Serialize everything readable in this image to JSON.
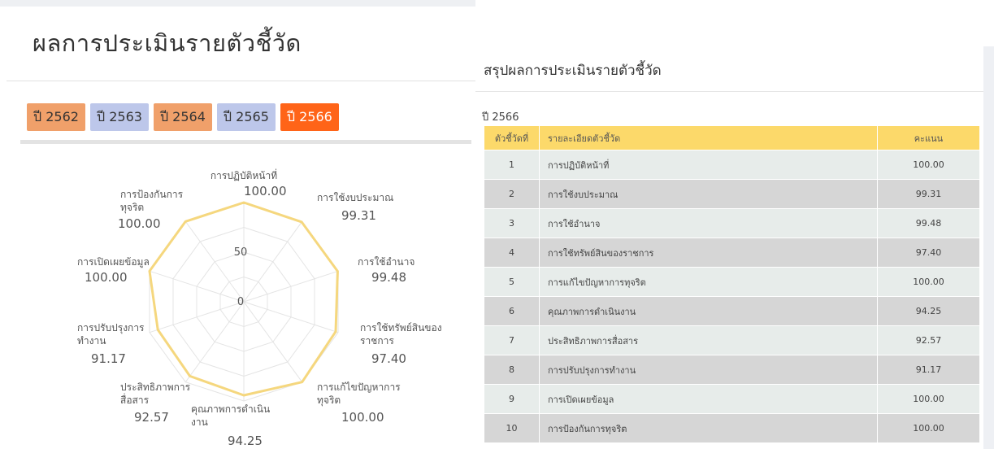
{
  "page_title": "ผลการประเมินรายตัวชี้วัด",
  "year_tabs": [
    {
      "label": "ปี 2562",
      "color": "#f0a06a",
      "active": false
    },
    {
      "label": "ปี 2563",
      "color": "#bdc7ea",
      "active": false
    },
    {
      "label": "ปี 2564",
      "color": "#f0a06a",
      "active": false
    },
    {
      "label": "ปี 2565",
      "color": "#bdc7ea",
      "active": false
    },
    {
      "label": "ปี 2566",
      "color": "#ff6418",
      "active": true
    }
  ],
  "chart_data": {
    "type": "radar",
    "rlim": [
      0,
      100
    ],
    "radial_ticks": [
      "0",
      "50",
      "100.00"
    ],
    "line_color": "#f5d77e",
    "axes": [
      {
        "label": "การปฏิบัติหน้าที่",
        "value": 100.0,
        "value_label": "100.00"
      },
      {
        "label": "การใช้งบประมาณ",
        "value": 99.31,
        "value_label": "99.31"
      },
      {
        "label": "การใช้อำนาจ",
        "value": 99.48,
        "value_label": "99.48"
      },
      {
        "label": "การใช้ทรัพย์สินของราชการ",
        "value": 97.4,
        "value_label": "97.40"
      },
      {
        "label": "การแก้ไขปัญหาการทุจริต",
        "value": 100.0,
        "value_label": "100.00"
      },
      {
        "label": "คุณภาพการดำเนินงาน",
        "value": 94.25,
        "value_label": "94.25"
      },
      {
        "label": "ประสิทธิภาพการสื่อสาร",
        "value": 92.57,
        "value_label": "92.57"
      },
      {
        "label": "การปรับปรุงการทำงาน",
        "value": 91.17,
        "value_label": "91.17"
      },
      {
        "label": "การเปิดเผยข้อมูล",
        "value": 100.0,
        "value_label": "100.00"
      },
      {
        "label": "การป้องกันการทุจริต",
        "value": 100.0,
        "value_label": "100.00"
      }
    ]
  },
  "summary": {
    "title": "สรุปผลการประเมินรายตัวชี้วัด",
    "year": "ปี 2566",
    "columns": {
      "no": "ตัวชี้วัดที่",
      "desc": "รายละเอียดตัวชี้วัด",
      "score": "คะแนน"
    },
    "rows": [
      {
        "no": "1",
        "desc": "การปฏิบัติหน้าที่",
        "score": "100.00"
      },
      {
        "no": "2",
        "desc": "การใช้งบประมาณ",
        "score": "99.31"
      },
      {
        "no": "3",
        "desc": "การใช้อำนาจ",
        "score": "99.48"
      },
      {
        "no": "4",
        "desc": "การใช้ทรัพย์สินของราชการ",
        "score": "97.40"
      },
      {
        "no": "5",
        "desc": "การแก้ไขปัญหาการทุจริต",
        "score": "100.00"
      },
      {
        "no": "6",
        "desc": "คุณภาพการดำเนินงาน",
        "score": "94.25"
      },
      {
        "no": "7",
        "desc": "ประสิทธิภาพการสื่อสาร",
        "score": "92.57"
      },
      {
        "no": "8",
        "desc": "การปรับปรุงการทำงาน",
        "score": "91.17"
      },
      {
        "no": "9",
        "desc": "การเปิดเผยข้อมูล",
        "score": "100.00"
      },
      {
        "no": "10",
        "desc": "การป้องกันการทุจริต",
        "score": "100.00"
      }
    ]
  }
}
